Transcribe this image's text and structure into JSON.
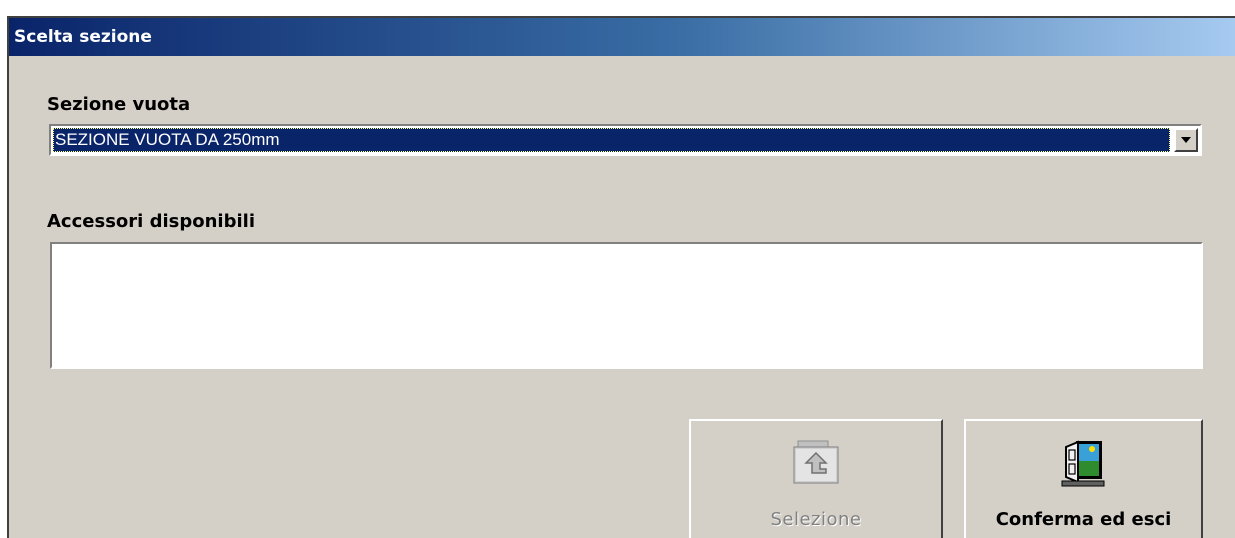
{
  "window": {
    "title": "Scelta sezione"
  },
  "section": {
    "label": "Sezione vuota",
    "selected_value": "SEZIONE VUOTA DA 250mm"
  },
  "accessories": {
    "label": "Accessori disponibili",
    "items": []
  },
  "buttons": {
    "select_label": "Selezione",
    "select_enabled": false,
    "confirm_label": "Conferma ed esci"
  },
  "colors": {
    "titlebar_start": "#0a246a",
    "titlebar_end": "#a6caf0",
    "selection": "#0a246a",
    "face": "#d4d0c8"
  },
  "icons": {
    "select": "folder-up-arrow-icon",
    "confirm": "exit-door-icon"
  }
}
